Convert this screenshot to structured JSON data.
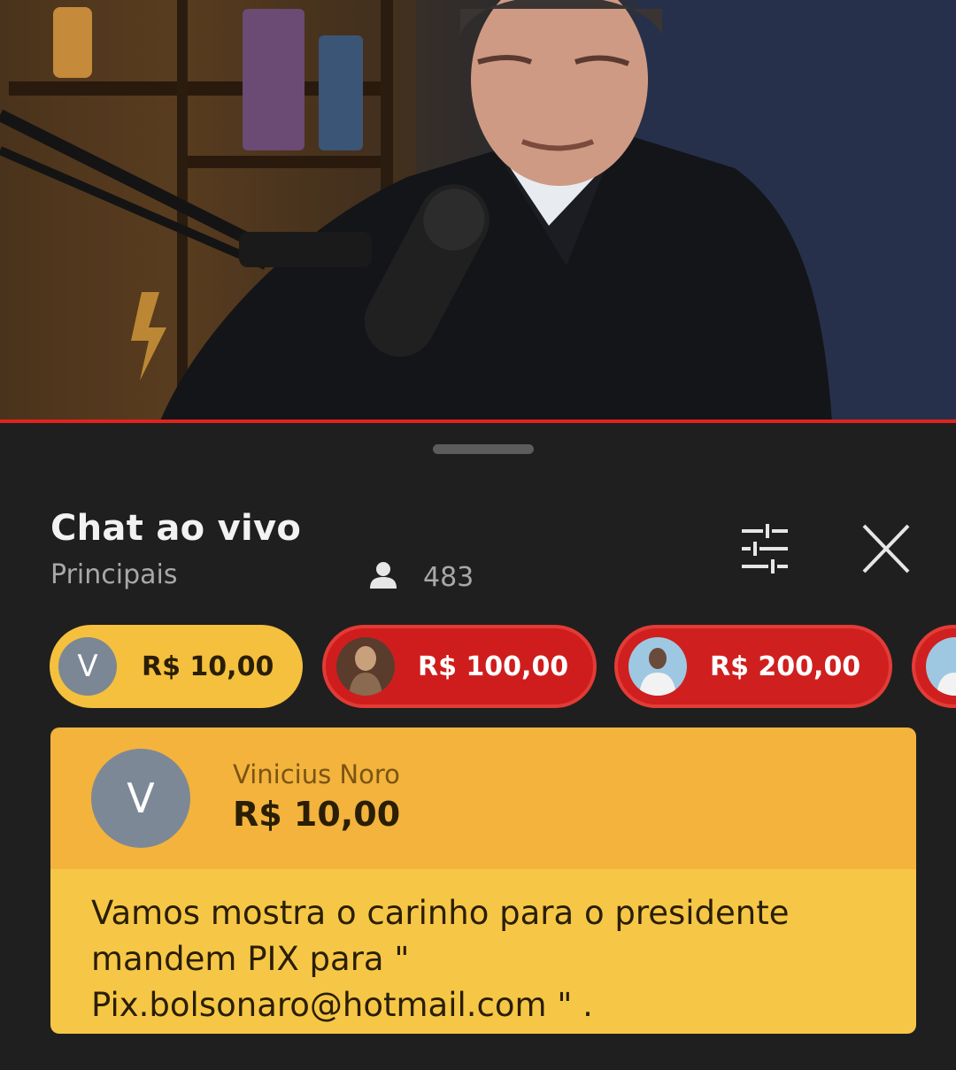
{
  "chat": {
    "title": "Chat ao vivo",
    "subtitle": "Principais",
    "viewer_count": "483"
  },
  "tickers": [
    {
      "avatar_letter": "V",
      "amount": "R$ 10,00",
      "color": "#f5c03d"
    },
    {
      "amount": "R$ 100,00",
      "color": "#cf1d1d"
    },
    {
      "amount": "R$ 200,00",
      "color": "#d01f1f"
    }
  ],
  "pinned": {
    "avatar_letter": "V",
    "author": "Vinicius Noro",
    "amount": "R$ 10,00",
    "message_lines": [
      "Vamos mostra o carinho para o presidente",
      "mandem PIX para \"",
      "Pix.bolsonaro@hotmail.com \" ."
    ],
    "header_color": "#f3b33c",
    "body_color": "#f6c746"
  },
  "icons": [
    "person-icon",
    "filter-sliders-icon",
    "close-icon"
  ],
  "accent_color": "#e0231f"
}
